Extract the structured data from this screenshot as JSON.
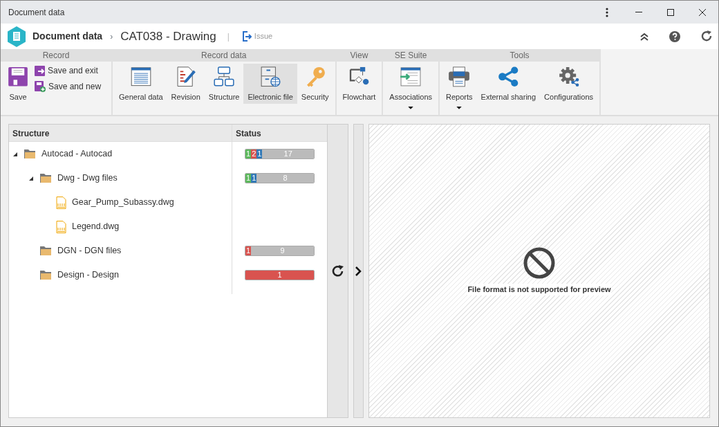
{
  "window": {
    "title": "Document data"
  },
  "header": {
    "module": "Document data",
    "separator": "›",
    "record": "CAT038 - Drawing",
    "divider": "|",
    "action": "Issue"
  },
  "ribbon": [
    {
      "label": "Record",
      "buttons": [
        {
          "kind": "large",
          "label": "Save",
          "selected": false,
          "dropdown": false
        },
        {
          "kind": "small",
          "label": "Save and exit",
          "selected": false
        },
        {
          "kind": "small",
          "label": "Save and new",
          "selected": false
        }
      ]
    },
    {
      "label": "Record data",
      "buttons": [
        {
          "kind": "large",
          "label": "General data",
          "selected": false,
          "dropdown": false
        },
        {
          "kind": "large",
          "label": "Revision",
          "selected": false,
          "dropdown": false
        },
        {
          "kind": "large",
          "label": "Structure",
          "selected": false,
          "dropdown": false
        },
        {
          "kind": "large",
          "label": "Electronic file",
          "selected": true,
          "dropdown": false
        },
        {
          "kind": "large",
          "label": "Security",
          "selected": false,
          "dropdown": false
        }
      ]
    },
    {
      "label": "View",
      "buttons": [
        {
          "kind": "large",
          "label": "Flowchart",
          "selected": false,
          "dropdown": false
        }
      ]
    },
    {
      "label": "SE Suite",
      "buttons": [
        {
          "kind": "large",
          "label": "Associations",
          "selected": false,
          "dropdown": true
        }
      ]
    },
    {
      "label": "Tools",
      "buttons": [
        {
          "kind": "large",
          "label": "Reports",
          "selected": false,
          "dropdown": true
        },
        {
          "kind": "large",
          "label": "External sharing",
          "selected": false,
          "dropdown": false
        },
        {
          "kind": "large",
          "label": "Configurations",
          "selected": false,
          "dropdown": false
        }
      ]
    }
  ],
  "tree": {
    "columns": [
      "Structure",
      "Status"
    ],
    "items": [
      {
        "kind": "folder",
        "label": "Autocad - Autocad",
        "expanded": true,
        "status": [
          {
            "text": "1",
            "color": "#5cb85c"
          },
          {
            "text": "2",
            "color": "#d9534f"
          },
          {
            "text": "1",
            "color": "#337ab7"
          },
          {
            "text": "17",
            "color": "#bbbbbb"
          }
        ],
        "children": [
          {
            "kind": "folder",
            "label": "Dwg - Dwg files",
            "expanded": true,
            "status": [
              {
                "text": "1",
                "color": "#5cb85c"
              },
              {
                "text": "1",
                "color": "#337ab7"
              },
              {
                "text": "8",
                "color": "#bbbbbb"
              }
            ],
            "children": [
              {
                "kind": "file",
                "label": "Gear_Pump_Subassy.dwg"
              },
              {
                "kind": "file",
                "label": "Legend.dwg"
              }
            ]
          },
          {
            "kind": "folder",
            "label": "DGN - DGN files",
            "status": [
              {
                "text": "1",
                "color": "#d9534f"
              },
              {
                "text": "9",
                "color": "#bbbbbb"
              }
            ]
          },
          {
            "kind": "folder",
            "label": "Design - Design",
            "status": [
              {
                "text": "1",
                "color": "#d9534f"
              }
            ]
          }
        ]
      }
    ]
  },
  "preview": {
    "message": "File format is not supported for preview"
  }
}
